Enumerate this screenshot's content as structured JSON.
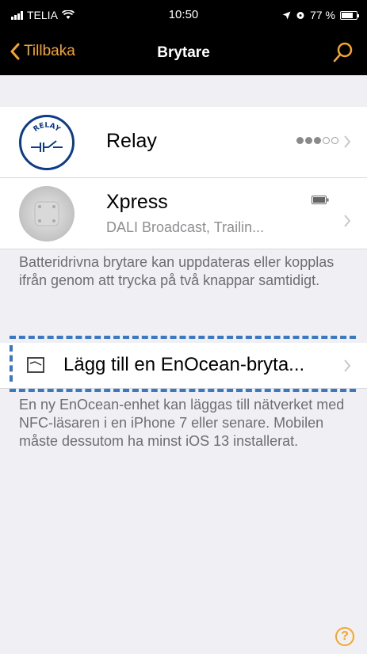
{
  "status": {
    "carrier": "TELIA",
    "time": "10:50",
    "battery": "77 %",
    "battery_level": 0.77
  },
  "nav": {
    "back_label": "Tillbaka",
    "title": "Brytare"
  },
  "devices": [
    {
      "name": "Relay",
      "icon": "relay-icon",
      "icon_text": "RELAY",
      "signal_strength": 3
    },
    {
      "name": "Xpress",
      "subtitle": "DALI Broadcast, Trailin...",
      "icon": "xpress-icon",
      "battery_icon": "battery-icon"
    }
  ],
  "info_text": "Batteridrivna brytare kan uppdateras eller kopplas ifrån genom att trycka på två knappar samtidigt.",
  "add_action": {
    "label": "Lägg till en EnOcean-bryta...",
    "icon": "enocean-switch-icon"
  },
  "enocean_note": "En ny EnOcean-enhet kan läggas till nätverket med NFC-läsaren i en iPhone 7 eller senare. Mobilen måste dessutom ha minst iOS 13 installerat.",
  "help": {
    "label": "?"
  },
  "colors": {
    "accent": "#f5a623",
    "highlight_dash": "#3a78c2",
    "background": "#efeff4"
  }
}
